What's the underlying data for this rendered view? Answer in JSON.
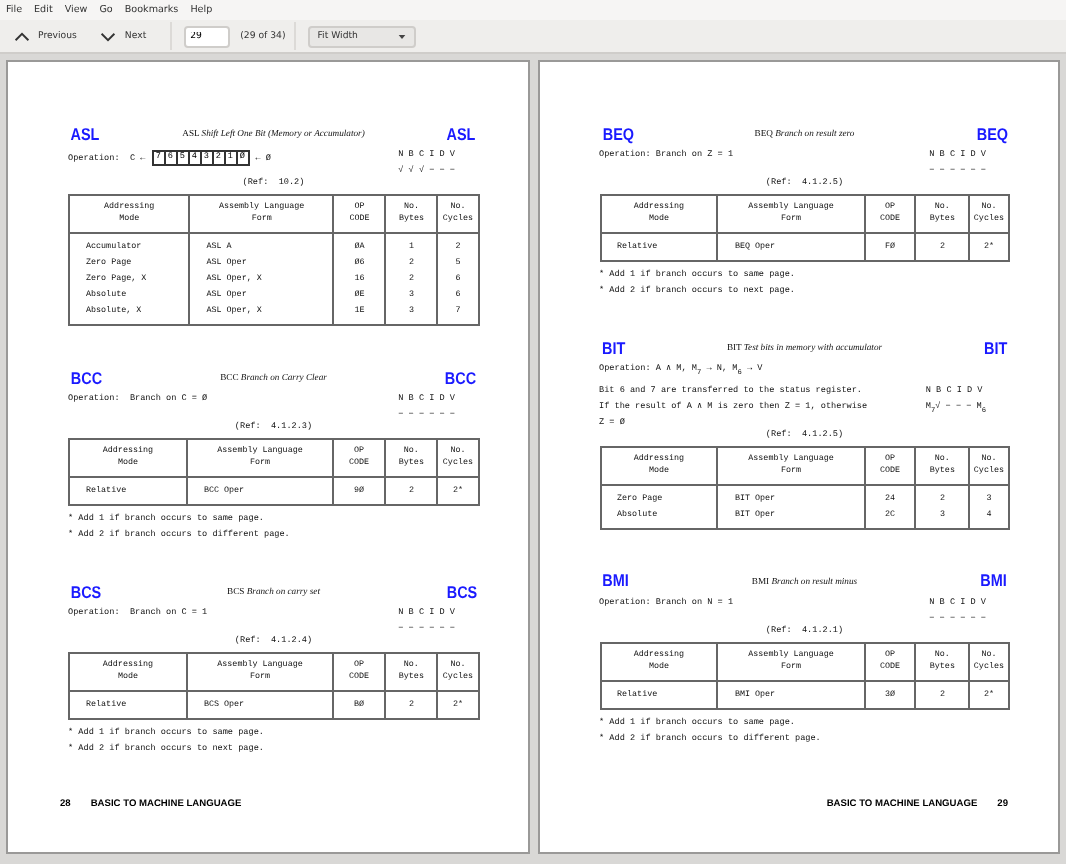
{
  "menu": [
    "File",
    "Edit",
    "View",
    "Go",
    "Bookmarks",
    "Help"
  ],
  "toolbar": {
    "previous": "Previous",
    "next": "Next",
    "page": "29",
    "page_count": "(29 of 34)",
    "zoom": "Fit Width"
  },
  "pages": [
    {
      "footer": [
        {
          "kind": "number",
          "text": "28"
        },
        {
          "kind": "title",
          "text": "BASIC TO MACHINE LANGUAGE"
        }
      ],
      "sections": [
        {
          "label_left": "ASL",
          "title": "ASL *Shift Left One Bit (Memory or Accumulator)*",
          "label_right": "ASL",
          "operation": {
            "kind": "shift",
            "prefix": "Operation:  C ←",
            "bits": [
              "7",
              "6",
              "5",
              "4",
              "3",
              "2",
              "1",
              "Ø"
            ],
            "suffix": "← Ø"
          },
          "flags_header": "N B C I D V",
          "flags": "√ √ √ − − −",
          "ref": "(Ref:  10.2)",
          "columns": [
            "Addressing Mode",
            "Assembly Language Form",
            "OP CODE",
            "No. Bytes",
            "No. Cycles"
          ],
          "rows": [
            [
              "Accumulator",
              "ASL A",
              "ØA",
              "1",
              "2"
            ],
            [
              "Zero Page",
              "ASL Oper",
              "Ø6",
              "2",
              "5"
            ],
            [
              "Zero Page, X",
              "ASL Oper, X",
              "16",
              "2",
              "6"
            ],
            [
              "Absolute",
              "ASL Oper",
              "ØE",
              "3",
              "6"
            ],
            [
              "Absolute, X",
              "ASL Oper, X",
              "1E",
              "3",
              "7"
            ]
          ]
        },
        {
          "label_left": "BCC",
          "title": "BCC *Branch on Carry Clear*",
          "label_right": "BCC",
          "operation": {
            "kind": "text",
            "lines": [
              "Operation:  Branch on C = Ø"
            ]
          },
          "flags_header": "N B C I D V",
          "flags": "− − − − − −",
          "ref": "(Ref:  4.1.2.3)",
          "columns": [
            "Addressing Mode",
            "Assembly Language Form",
            "OP CODE",
            "No. Bytes",
            "No. Cycles"
          ],
          "rows": [
            [
              "Relative",
              "BCC  Oper",
              "9Ø",
              "2",
              "2*"
            ]
          ],
          "notes": [
            "* Add 1 if branch occurs to same page.",
            "* Add 2 if branch occurs to different page."
          ]
        },
        {
          "label_left": "BCS",
          "title": "BCS *Branch on carry set*",
          "label_right": "BCS",
          "operation": {
            "kind": "text",
            "lines": [
              "Operation:  Branch on C = 1"
            ]
          },
          "flags_header": "N B C I D V",
          "flags": "− − − − − −",
          "ref": "(Ref:  4.1.2.4)",
          "columns": [
            "Addressing Mode",
            "Assembly Language Form",
            "OP CODE",
            "No. Bytes",
            "No. Cycles"
          ],
          "rows": [
            [
              "Relative",
              "BCS  Oper",
              "BØ",
              "2",
              "2*"
            ]
          ],
          "notes": [
            "* Add 1 if branch occurs to same page.",
            "* Add 2 if branch occurs to next page."
          ]
        }
      ]
    },
    {
      "footer": [
        {
          "kind": "title",
          "text": "BASIC TO MACHINE LANGUAGE"
        },
        {
          "kind": "number",
          "text": "29"
        }
      ],
      "sections": [
        {
          "label_left": "BEQ",
          "title": "BEQ *Branch on result zero*",
          "label_right": "BEQ",
          "operation": {
            "kind": "text",
            "lines": [
              "Operation: Branch on Z = 1"
            ]
          },
          "flags_header": "N B C I D V",
          "flags": "− − − − − −",
          "ref": "(Ref:  4.1.2.5)",
          "columns": [
            "Addressing Mode",
            "Assembly Language Form",
            "OP CODE",
            "No. Bytes",
            "No. Cycles"
          ],
          "rows": [
            [
              "Relative",
              "BEQ  Oper",
              "FØ",
              "2",
              "2*"
            ]
          ],
          "notes": [
            "* Add 1 if branch occurs to same page.",
            "* Add 2 if branch occurs to next page."
          ]
        },
        {
          "label_left": "BIT",
          "title": "BIT *Test bits in memory with accumulator*",
          "label_right": "BIT",
          "operation": {
            "kind": "paragraph",
            "lines": [
              "Operation: A ∧ M, M$_{7}$ → N, M$_{6}$ → V",
              "Bit 6 and 7 are transferred to the status register.",
              "If the result of A ∧ M is zero then Z = 1, otherwise",
              "Z = Ø"
            ]
          },
          "flags_header": "N B C I D V",
          "flags": "M$_{7}$√ − − − M$_{6}$",
          "ref": "(Ref:  4.1.2.5)",
          "columns": [
            "Addressing Mode",
            "Assembly Language Form",
            "OP CODE",
            "No. Bytes",
            "No. Cycles"
          ],
          "rows": [
            [
              "Zero Page",
              "BIT  Oper",
              "24",
              "2",
              "3"
            ],
            [
              "Absolute",
              "BIT  Oper",
              "2C",
              "3",
              "4"
            ]
          ]
        },
        {
          "label_left": "BMI",
          "title": "BMI *Branch on result minus*",
          "label_right": "BMI",
          "operation": {
            "kind": "text",
            "lines": [
              "Operation: Branch on N = 1"
            ]
          },
          "flags_header": "N B C I D V",
          "flags": "− − − − − −",
          "ref": "(Ref:  4.1.2.1)",
          "columns": [
            "Addressing Mode",
            "Assembly Language Form",
            "OP CODE",
            "No. Bytes",
            "No. Cycles"
          ],
          "rows": [
            [
              "Relative",
              "BMI  Oper",
              "3Ø",
              "2",
              "2*"
            ]
          ],
          "notes": [
            "* Add 1 if branch occurs to same page.",
            "* Add 2 if branch occurs to different page."
          ]
        }
      ]
    }
  ]
}
